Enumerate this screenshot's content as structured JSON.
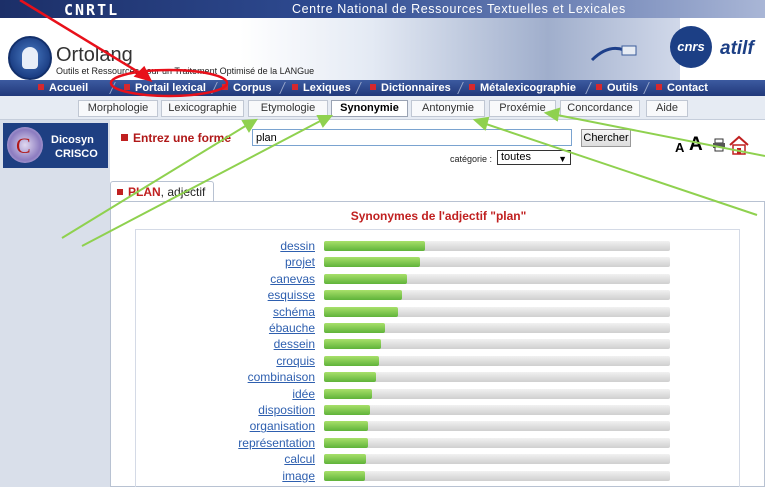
{
  "header": {
    "cnrtl_logo": "CNRTL",
    "site_title": "Centre National de Ressources Textuelles et Lexicales",
    "ortolang_name": "Ortolang",
    "ortolang_tagline": "Outils et Ressources pour un Traitement Optimisé de la LANGue",
    "cnrs_logo": "cnrs",
    "atilf_logo": "atilf"
  },
  "main_nav": [
    {
      "label": "Accueil"
    },
    {
      "label": "Portail lexical"
    },
    {
      "label": "Corpus"
    },
    {
      "label": "Lexiques"
    },
    {
      "label": "Dictionnaires"
    },
    {
      "label": "Métalexicographie"
    },
    {
      "label": "Outils"
    },
    {
      "label": "Contact"
    }
  ],
  "sub_nav": [
    {
      "label": "Morphologie"
    },
    {
      "label": "Lexicographie"
    },
    {
      "label": "Etymologie"
    },
    {
      "label": "Synonymie",
      "active": true
    },
    {
      "label": "Antonymie"
    },
    {
      "label": "Proxémie"
    },
    {
      "label": "Concordance"
    },
    {
      "label": "Aide"
    }
  ],
  "sidebar": {
    "dicosyn_line1": "Dicosyn",
    "dicosyn_line2": "CRISCO"
  },
  "search": {
    "label": "Entrez une forme",
    "value": "plan",
    "button": "Chercher",
    "category_label": "catégorie :",
    "category_value": "toutes"
  },
  "result": {
    "tab_word": "PLAN",
    "tab_category": ", adjectif",
    "heading": "Synonymes de l'adjectif \"plan\"",
    "synonyms": [
      {
        "word": "dessin",
        "score": 0.055
      },
      {
        "word": "projet",
        "score": 0.052
      },
      {
        "word": "canevas",
        "score": 0.045
      },
      {
        "word": "esquisse",
        "score": 0.042
      },
      {
        "word": "schéma",
        "score": 0.04
      },
      {
        "word": "ébauche",
        "score": 0.033
      },
      {
        "word": "dessein",
        "score": 0.031
      },
      {
        "word": "croquis",
        "score": 0.03
      },
      {
        "word": "combinaison",
        "score": 0.028
      },
      {
        "word": "idée",
        "score": 0.026
      },
      {
        "word": "disposition",
        "score": 0.025
      },
      {
        "word": "organisation",
        "score": 0.024
      },
      {
        "word": "représentation",
        "score": 0.024
      },
      {
        "word": "calcul",
        "score": 0.023
      },
      {
        "word": "image",
        "score": 0.022
      }
    ]
  },
  "colors": {
    "nav_blue": "#21397a",
    "accent_red": "#c02020",
    "link_blue": "#2e5faf",
    "bar_green": "#5fb33a",
    "annotation_green": "#8fd14f",
    "annotation_red": "#e8101a"
  }
}
